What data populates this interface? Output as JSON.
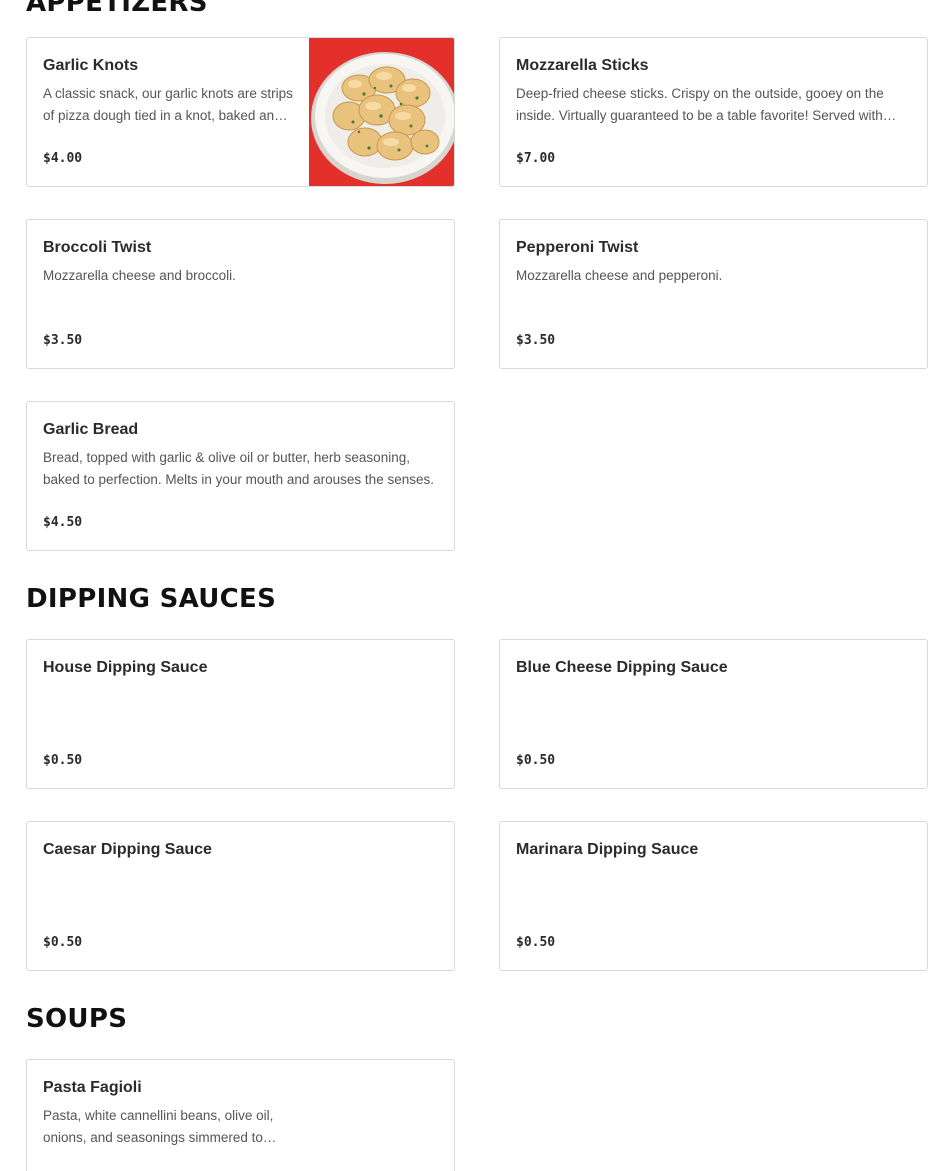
{
  "sections": {
    "appetizers": {
      "title": "APPETIZERS",
      "items": [
        {
          "name": "Garlic Knots",
          "description": "A classic snack, our garlic knots are strips of pizza dough tied in a knot, baked and brushed with garlic butter.",
          "price": "$4.00",
          "image": "garlic-knots-photo"
        },
        {
          "name": "Mozzarella Sticks",
          "description": "Deep-fried cheese sticks. Crispy on the outside, gooey on the inside. Virtually guaranteed to be a table favorite! Served with marinara sauce.",
          "price": "$7.00"
        },
        {
          "name": "Broccoli Twist",
          "description": "Mozzarella cheese and broccoli.",
          "price": "$3.50"
        },
        {
          "name": "Pepperoni Twist",
          "description": "Mozzarella cheese and pepperoni.",
          "price": "$3.50"
        },
        {
          "name": "Garlic Bread",
          "description": "Bread, topped with garlic & olive oil or butter, herb seasoning, baked to perfection. Melts in your mouth and arouses the senses.",
          "price": "$4.50"
        }
      ]
    },
    "dipping_sauces": {
      "title": "DIPPING SAUCES",
      "items": [
        {
          "name": "House Dipping Sauce",
          "price": "$0.50"
        },
        {
          "name": "Blue Cheese Dipping Sauce",
          "price": "$0.50"
        },
        {
          "name": "Caesar Dipping Sauce",
          "price": "$0.50"
        },
        {
          "name": "Marinara Dipping Sauce",
          "price": "$0.50"
        }
      ]
    },
    "soups": {
      "title": "SOUPS",
      "items": [
        {
          "name": "Pasta Fagioli",
          "description": "Pasta, white cannellini beans, olive oil, onions, and seasonings simmered to perfection.",
          "price": ""
        }
      ]
    }
  },
  "colors": {
    "card_border": "#d9d9d9",
    "photo_background": "#e8322b",
    "heading": "#111111"
  }
}
